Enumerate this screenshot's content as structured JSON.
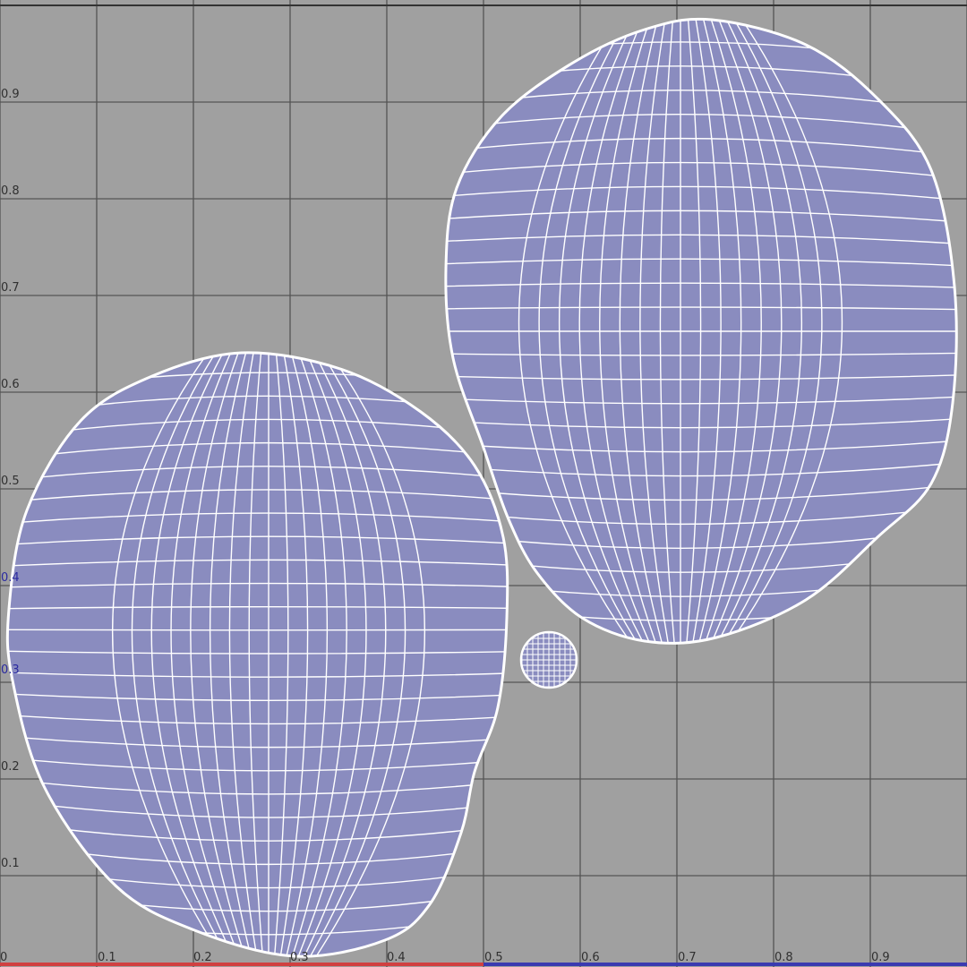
{
  "editor": {
    "x_ticks": [
      "0",
      "0.1",
      "0.2",
      "0.3",
      "0.4",
      "0.5",
      "0.6",
      "0.7",
      "0.8",
      "0.9"
    ],
    "y_ticks": [
      "0.9",
      "0.8",
      "0.7",
      "0.6",
      "0.5",
      "0.4",
      "0.3",
      "0.2",
      "0.1"
    ],
    "colors": {
      "background": "#a0a0a0",
      "grid_major": "#555555",
      "grid_uv_boundary": "#3a3ab0",
      "uv_shell_fill": "#8a8cbf",
      "uv_wire": "#ffffff",
      "u_axis": "#d04040",
      "v_axis": "#3a3ab0"
    },
    "shells": [
      {
        "name": "left-uv-shell",
        "kind": "uv-shell"
      },
      {
        "name": "right-uv-shell",
        "kind": "uv-shell"
      },
      {
        "name": "small-uv-shell",
        "kind": "uv-shell"
      }
    ]
  }
}
